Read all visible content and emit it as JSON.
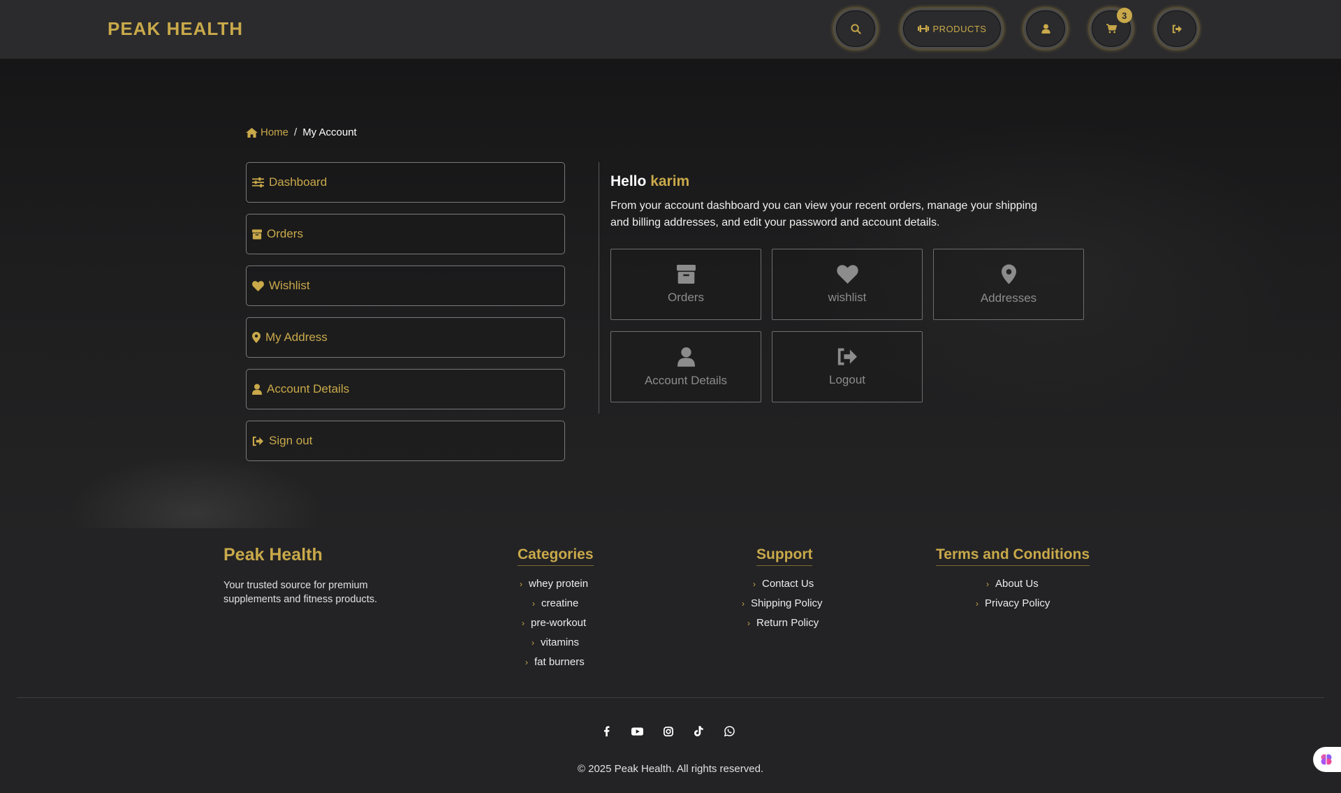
{
  "header": {
    "brand": "PEAK HEALTH",
    "products_label": "PRODUCTS",
    "cart_count": "3",
    "icons": [
      "search-icon",
      "dumbbell-icon",
      "user-icon",
      "cart-icon",
      "sign-out-icon"
    ]
  },
  "breadcrumb": {
    "home": "Home",
    "separator": "/",
    "current": "My Account"
  },
  "sidebar": {
    "items": [
      {
        "label": "Dashboard",
        "icon": "sliders-icon"
      },
      {
        "label": "Orders",
        "icon": "box-icon"
      },
      {
        "label": "Wishlist",
        "icon": "heart-icon"
      },
      {
        "label": "My Address",
        "icon": "map-pin-icon"
      },
      {
        "label": "Account Details",
        "icon": "user-icon"
      },
      {
        "label": "Sign out",
        "icon": "sign-out-icon"
      }
    ]
  },
  "dashboard": {
    "greeting": "Hello",
    "username": "karim",
    "intro": "From your account dashboard you can view your recent orders, manage your shipping and billing addresses, and edit your password and account details.",
    "tiles": [
      {
        "label": "Orders",
        "icon": "box-icon"
      },
      {
        "label": "wishlist",
        "icon": "heart-icon"
      },
      {
        "label": "Addresses",
        "icon": "map-pin-icon"
      },
      {
        "label": "Account Details",
        "icon": "user-icon"
      },
      {
        "label": "Logout",
        "icon": "sign-out-icon"
      }
    ]
  },
  "footer": {
    "brand": "Peak Health",
    "description": "Your trusted source for premium supplements and fitness products.",
    "categories": {
      "title": "Categories",
      "links": [
        "whey protein",
        "creatine",
        "pre-workout",
        "vitamins",
        "fat burners"
      ]
    },
    "support": {
      "title": "Support",
      "links": [
        "Contact Us",
        "Shipping Policy",
        "Return Policy"
      ]
    },
    "terms": {
      "title": "Terms and Conditions",
      "links": [
        "About Us",
        "Privacy Policy"
      ]
    },
    "socials": [
      "facebook-icon",
      "youtube-icon",
      "instagram-icon",
      "tiktok-icon",
      "whatsapp-icon"
    ],
    "copyright": "© 2025 Peak Health. All rights reserved."
  },
  "colors": {
    "accent": "#c9a94a",
    "background": "#1e1e20",
    "navbar": "#2b2b2d",
    "muted_text": "#8c8c8c"
  }
}
